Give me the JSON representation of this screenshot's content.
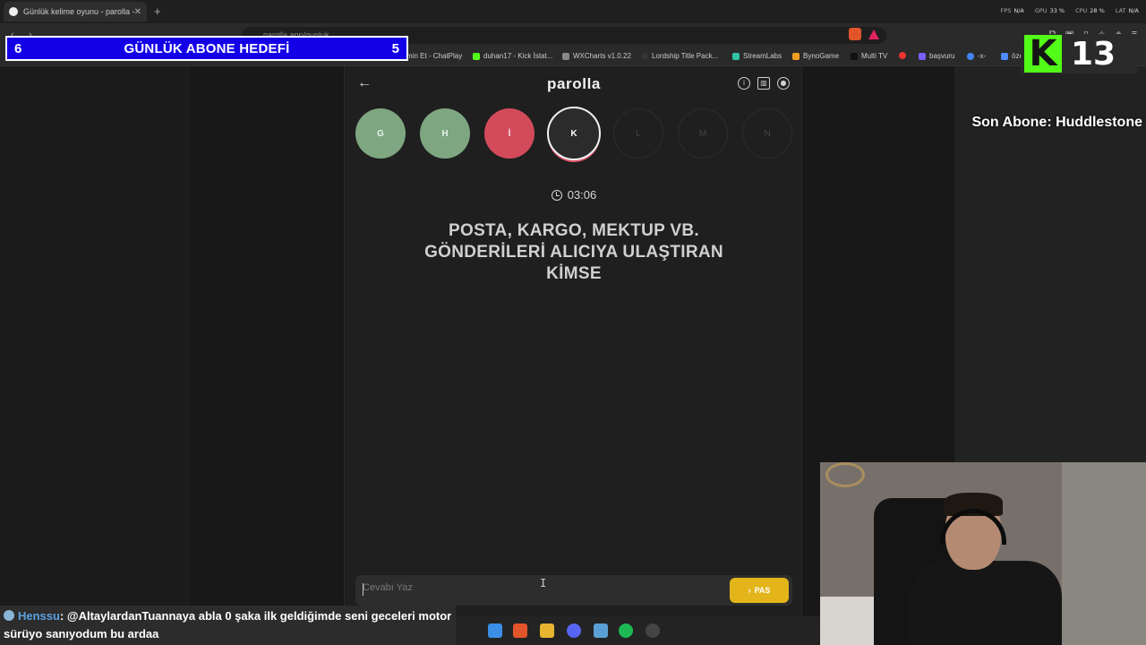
{
  "browser": {
    "tab_title": "Günlük kelime oyunu - parolla -",
    "tab_close": "✕",
    "new_tab": "+",
    "url": "parolla.app/gunluk",
    "perf": [
      {
        "label": "FPS",
        "value": "N/A"
      },
      {
        "label": "GPU",
        "value": "33 %"
      },
      {
        "label": "CPU",
        "value": "28 %"
      },
      {
        "label": "LAT",
        "value": "N/A"
      }
    ],
    "bookmarks": [
      {
        "label": "min Et - ChatPlay",
        "color": "#000000"
      },
      {
        "label": "duhan17 - Kick İstat...",
        "color": "#53fc18"
      },
      {
        "label": "WXCharts v1.0.22",
        "color": "#888888"
      },
      {
        "label": "Lordship Title Pack...",
        "color": "#222222"
      },
      {
        "label": "StreamLabs",
        "color": "#31c3a2"
      },
      {
        "label": "BynoGame",
        "color": "#f0a020"
      },
      {
        "label": "Multi TV",
        "color": "#111111"
      },
      {
        "label": "",
        "color": "#e33"
      },
      {
        "label": "başvuru",
        "color": "#7b5cff"
      },
      {
        "label": "-x-",
        "color": "#4285f4"
      },
      {
        "label": "özel",
        "color": "#4e8cff"
      }
    ],
    "more": "»"
  },
  "overlay": {
    "goal_left": "6",
    "goal_title": "GÜNLÜK ABONE HEDEFİ",
    "goal_right": "5",
    "kick_logo": "K",
    "kick_count": "13",
    "last_sub": "Son Abone: Huddlestone"
  },
  "app": {
    "brand": "parolla",
    "back": "←",
    "letters": [
      {
        "char": "G",
        "state": "ok"
      },
      {
        "char": "H",
        "state": "ok"
      },
      {
        "char": "İ",
        "state": "bad"
      },
      {
        "char": "K",
        "state": "active"
      },
      {
        "char": "L",
        "state": "pending"
      },
      {
        "char": "M",
        "state": "pending"
      },
      {
        "char": "N",
        "state": "pending"
      }
    ],
    "timer": "03:06",
    "question": "POSTA, KARGO, MEKTUP VB. GÖNDERİLERİ ALICIYA ULAŞTIRAN KİMSE",
    "answer_placeholder": "Cevabı Yaz",
    "pass_label": "PAS",
    "colors": {
      "ok": "#7ea781",
      "bad": "#d34b5b",
      "pass": "#e3b51b"
    }
  },
  "chat": {
    "user": "Henssu",
    "message": ": @AltaylardanTuannaya abla 0 şaka ilk geldiğimde seni geceleri motor sürüyo sanıyodum bu ardaa"
  }
}
